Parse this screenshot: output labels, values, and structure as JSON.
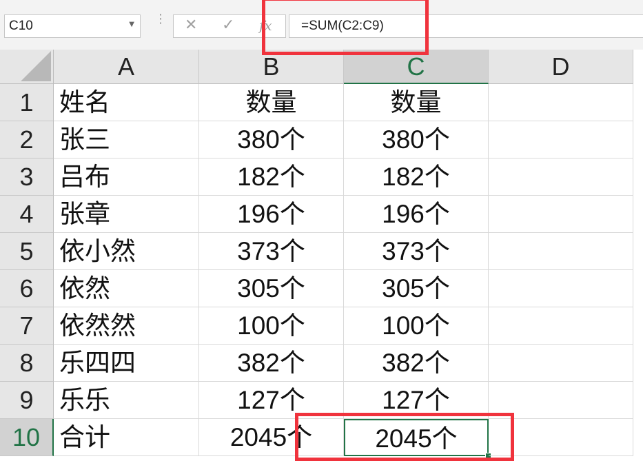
{
  "name_box": {
    "value": "C10"
  },
  "formula_bar": {
    "cancel_glyph": "✕",
    "enter_glyph": "✓",
    "fx_label": "fx",
    "formula": "=SUM(C2:C9)"
  },
  "columns": [
    "A",
    "B",
    "C",
    "D"
  ],
  "selected_column": "C",
  "selected_row": 10,
  "rows": [
    {
      "num": "1",
      "a": "姓名",
      "b": "数量",
      "c": "数量"
    },
    {
      "num": "2",
      "a": "张三",
      "b": "380个",
      "c": "380个"
    },
    {
      "num": "3",
      "a": "吕布",
      "b": "182个",
      "c": "182个"
    },
    {
      "num": "4",
      "a": "张章",
      "b": "196个",
      "c": "196个"
    },
    {
      "num": "5",
      "a": "依小然",
      "b": "373个",
      "c": "373个"
    },
    {
      "num": "6",
      "a": "依然",
      "b": "305个",
      "c": "305个"
    },
    {
      "num": "7",
      "a": "依然然",
      "b": "100个",
      "c": "100个"
    },
    {
      "num": "8",
      "a": "乐四四",
      "b": "382个",
      "c": "382个"
    },
    {
      "num": "9",
      "a": "乐乐",
      "b": "127个",
      "c": "127个"
    },
    {
      "num": "10",
      "a": "合计",
      "b": "2045个",
      "c": "2045个"
    }
  ],
  "colors": {
    "accent": "#217346",
    "annotation": "#f0333d",
    "header_bg": "#e6e6e6"
  }
}
